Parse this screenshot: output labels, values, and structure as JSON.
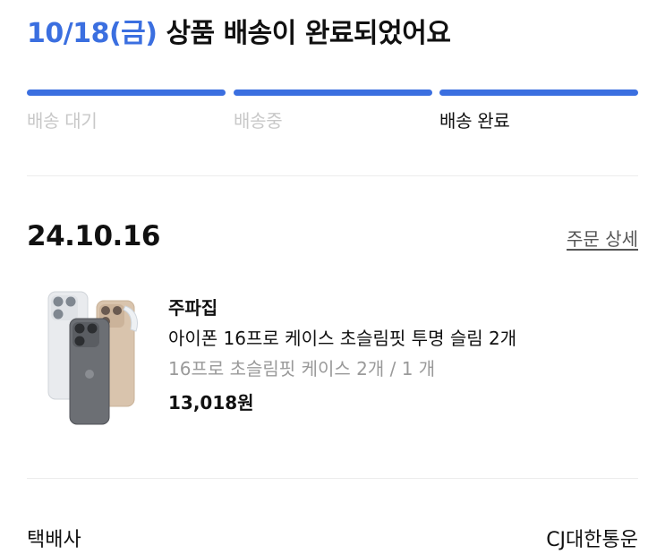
{
  "header": {
    "date": "10/18(금)",
    "title": "상품 배송이 완료되었어요"
  },
  "progress": {
    "accent_color": "#3b6fe0",
    "steps": [
      {
        "label": "배송 대기",
        "state": "done"
      },
      {
        "label": "배송중",
        "state": "done"
      },
      {
        "label": "배송 완료",
        "state": "current"
      }
    ]
  },
  "order": {
    "date": "24.10.16",
    "detail_link": "주문 상세"
  },
  "product": {
    "shop": "주파집",
    "name": "아이폰 16프로 케이스 초슬림핏 투명 슬림 2개",
    "option": "16프로 초슬림핏 케이스 2개 / 1 개",
    "price": "13,018원",
    "image_icon": "phone-case-image"
  },
  "carrier": {
    "label": "택배사",
    "value": "CJ대한통운"
  }
}
